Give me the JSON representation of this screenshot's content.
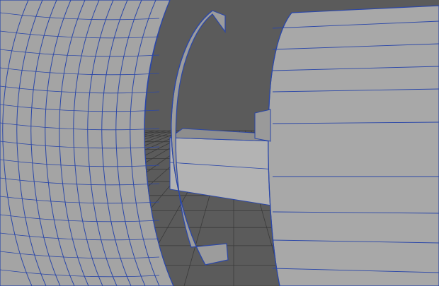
{
  "viewport": {
    "background_color": "#5b5b5b",
    "shaded_surface_color": "#a9a9a9",
    "wireframe_color": "#2b47a8",
    "grid_color": "#3a3a3a"
  },
  "objects": [
    {
      "name": "torus-ring-mesh"
    },
    {
      "name": "ring-flange-mesh"
    },
    {
      "name": "shaft-mesh"
    },
    {
      "name": "cylinder-hub-mesh"
    },
    {
      "name": "ground-grid"
    }
  ]
}
